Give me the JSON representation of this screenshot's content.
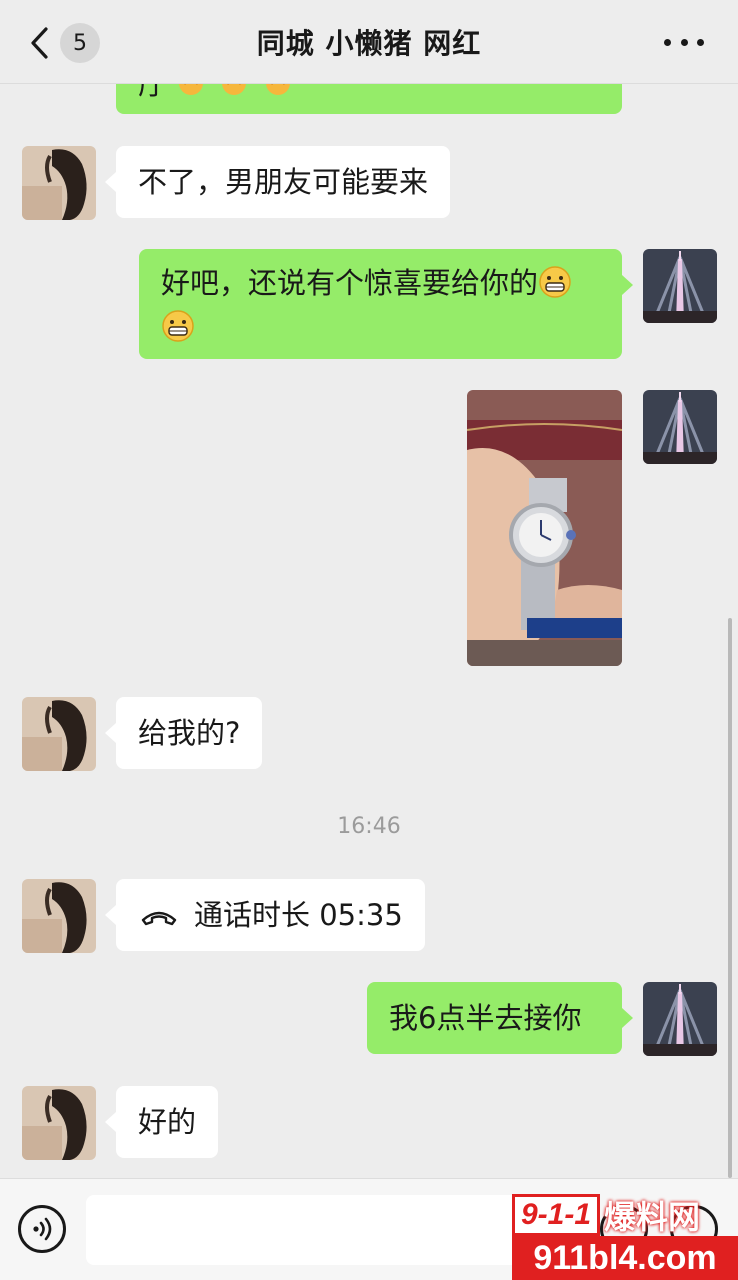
{
  "header": {
    "title": "同城 小懒猪 网红",
    "unread_count": "5"
  },
  "messages": [
    {
      "side": "out",
      "text_cut": "厅"
    },
    {
      "side": "in",
      "text": "不了，男朋友可能要来"
    },
    {
      "side": "out",
      "text": "好吧，还说有个惊喜要给你的",
      "emoji": "grin-emoji"
    },
    {
      "side": "out",
      "type": "image",
      "content": "watch-photo"
    },
    {
      "side": "in",
      "text": "给我的?"
    },
    {
      "type": "time",
      "text": "16:46"
    },
    {
      "side": "in",
      "type": "call",
      "text": "通话时长 05:35"
    },
    {
      "side": "out",
      "text": "我6点半去接你"
    },
    {
      "side": "in",
      "text": "好的"
    }
  ],
  "input": {
    "placeholder": ""
  },
  "watermark": {
    "top_num": "9-1-1",
    "top_text": "爆料网",
    "bottom": "911bl4.com"
  },
  "colors": {
    "background": "#ededed",
    "outgoing": "#95ec69",
    "incoming": "#ffffff",
    "watermark": "#e02020"
  }
}
